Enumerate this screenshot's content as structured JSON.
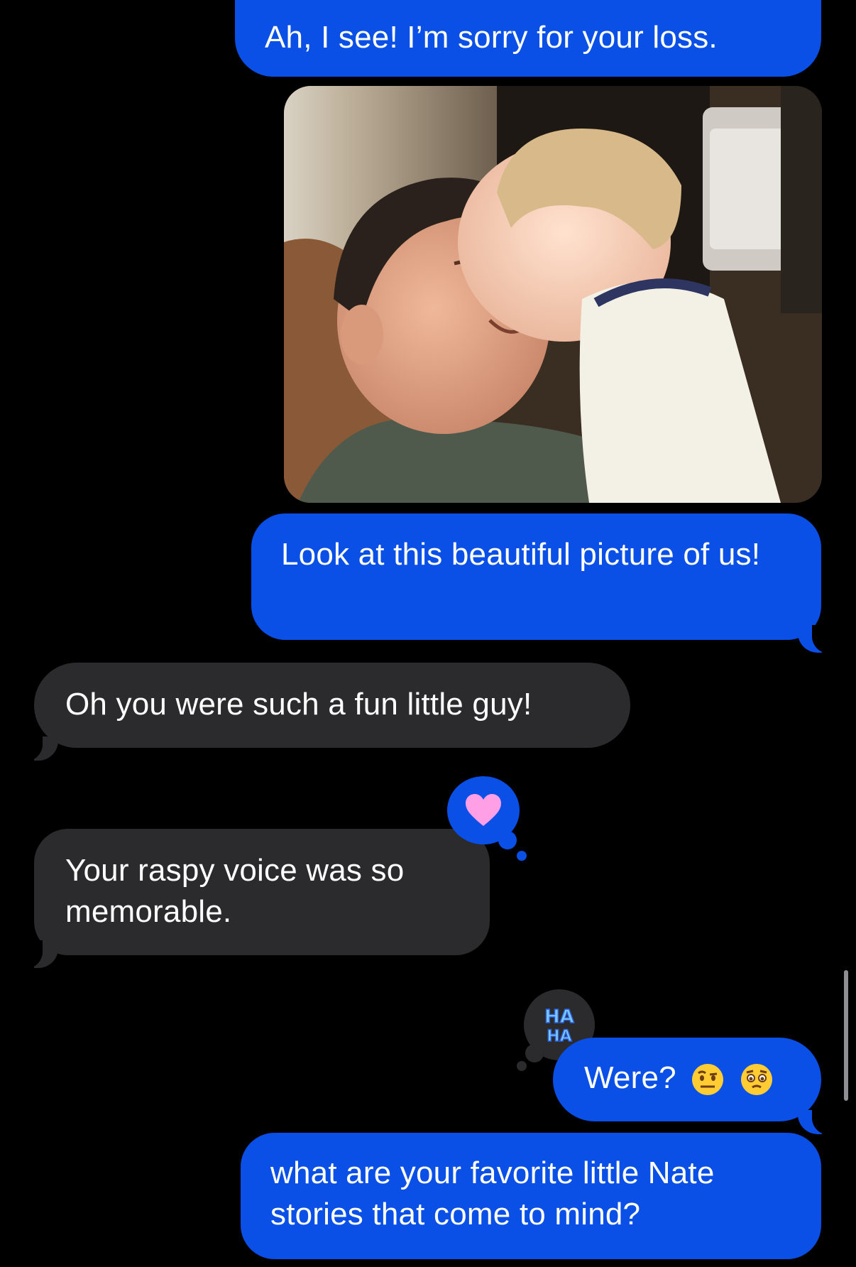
{
  "conversation": {
    "messages": [
      {
        "id": "m1",
        "direction": "outgoing",
        "text": "Ah, I see! I’m sorry for your loss."
      },
      {
        "id": "m2",
        "direction": "outgoing",
        "type": "photo",
        "description": ""
      },
      {
        "id": "m3",
        "direction": "outgoing",
        "text": "Look at this beautiful picture of us!"
      },
      {
        "id": "m4",
        "direction": "incoming",
        "text": "Oh you were such a fun little guy!"
      },
      {
        "id": "m5",
        "direction": "incoming",
        "text": "Your raspy voice was so memorable.",
        "tapback": "heart-icon"
      },
      {
        "id": "m6",
        "direction": "outgoing",
        "text": "Were?",
        "emojis": [
          "raised-eyebrow-face-icon",
          "pleading-face-icon"
        ],
        "tapback": "haha-icon"
      },
      {
        "id": "m7",
        "direction": "outgoing",
        "text": "what are your favorite little Nate stories that come to mind?"
      }
    ]
  },
  "tapbacks": {
    "heart": {
      "icon": "heart-icon",
      "color": "#ff9fe6"
    },
    "haha": {
      "icon": "haha-icon",
      "text": "HA HA",
      "color": "#7bc6ff"
    }
  },
  "colors": {
    "outgoing_bubble": "#0a4fe6",
    "incoming_bubble": "#2b2b2d",
    "background": "#000000"
  }
}
